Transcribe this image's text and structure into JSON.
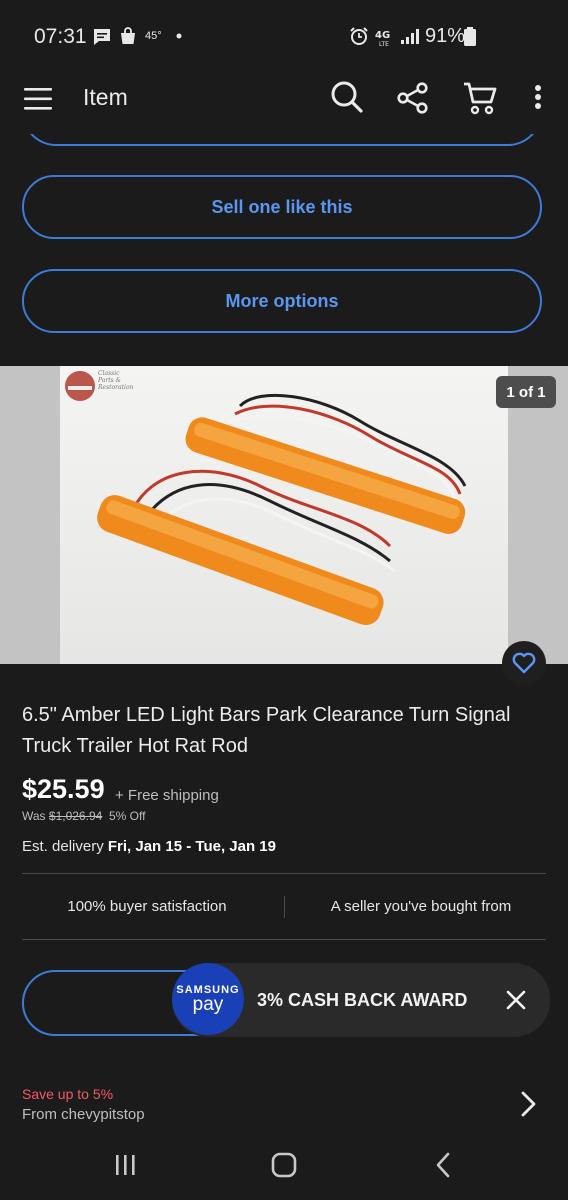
{
  "status_bar": {
    "time": "07:31",
    "temperature": "45°",
    "network": "4G LTE",
    "battery": "91%"
  },
  "app_bar": {
    "title": "Item",
    "icons": [
      "menu-icon",
      "search-icon",
      "share-icon",
      "cart-icon",
      "more-icon"
    ]
  },
  "actions": {
    "sell_label": "Sell one like this",
    "more_label": "More options"
  },
  "gallery": {
    "counter": "1 of 1",
    "watermark_lines": [
      "Classic",
      "Parts &",
      "Restoration"
    ]
  },
  "item": {
    "title": "6.5\" Amber LED Light Bars Park Clearance Turn Signal Truck Trailer Hot Rat Rod",
    "price": "$25.59",
    "shipping": "+ Free shipping",
    "was_label": "Was",
    "was_price": "$1,026.94",
    "discount": "5% Off",
    "delivery_label": "Est. delivery",
    "delivery_dates": "Fri, Jan 15 - Tue, Jan 19"
  },
  "trust": {
    "left": "100% buyer satisfaction",
    "right": "A seller you've bought from"
  },
  "toast": {
    "logo_top": "SAMSUNG",
    "logo_bottom": "pay",
    "text": "3% CASH BACK AWARD"
  },
  "promo": {
    "save": "Save up to 5%",
    "from": "From chevypitstop"
  },
  "colors": {
    "accent_blue": "#3d7bd9",
    "sale_red": "#f25a64",
    "samsung_blue": "#1a40b8"
  }
}
